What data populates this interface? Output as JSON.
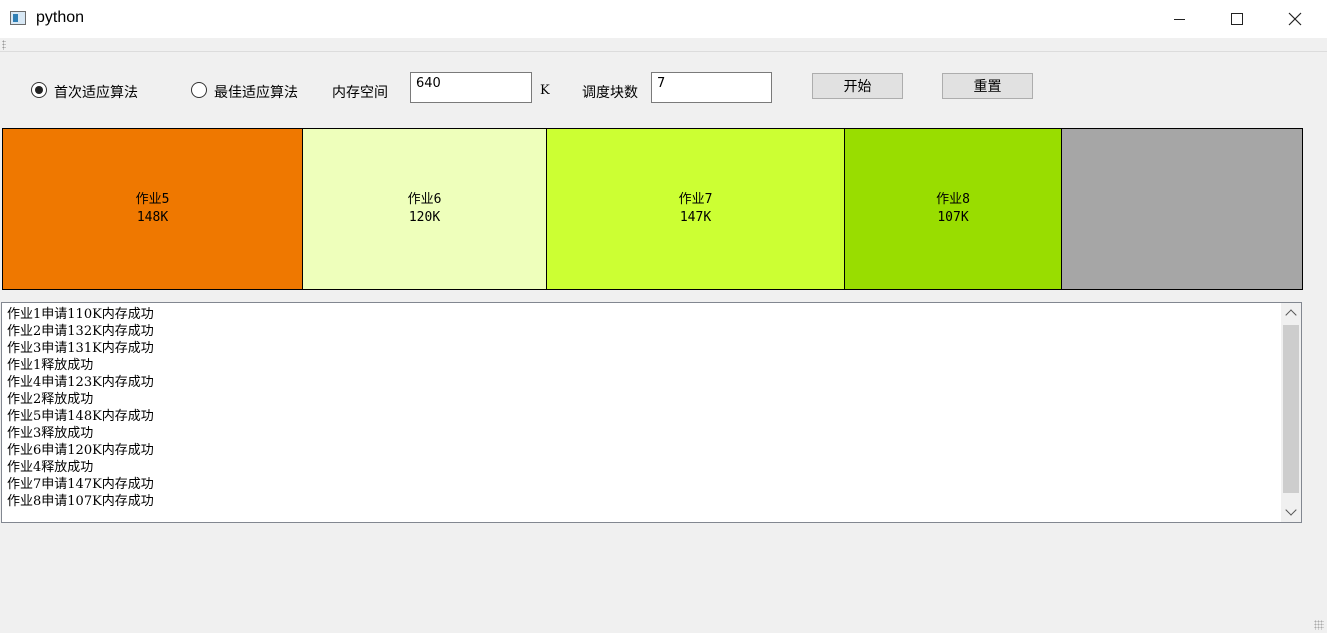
{
  "window": {
    "title": "python"
  },
  "controls": {
    "algo_first_fit": {
      "label": "首次适应算法",
      "checked": true
    },
    "algo_best_fit": {
      "label": "最佳适应算法",
      "checked": false
    },
    "memory_label": "内存空间",
    "memory_value": "640",
    "memory_unit": "K",
    "blocks_label": "调度块数",
    "blocks_value": "7",
    "start_label": "开始",
    "reset_label": "重置"
  },
  "memory": {
    "total_k": 640,
    "blocks": [
      {
        "name": "作业5",
        "size_label": "148K",
        "size_k": 148,
        "color": "#ef7800"
      },
      {
        "name": "作业6",
        "size_label": "120K",
        "size_k": 120,
        "color": "#eeffbb"
      },
      {
        "name": "作业7",
        "size_label": "147K",
        "size_k": 147,
        "color": "#ccff33"
      },
      {
        "name": "作业8",
        "size_label": "107K",
        "size_k": 107,
        "color": "#99dd00"
      }
    ],
    "free_color": "#a6a6a6"
  },
  "log": [
    "作业1申请110K内存成功",
    "作业2申请132K内存成功",
    "作业3申请131K内存成功",
    "作业1释放成功",
    "作业4申请123K内存成功",
    "作业2释放成功",
    "作业5申请148K内存成功",
    "作业3释放成功",
    "作业6申请120K内存成功",
    "作业4释放成功",
    "作业7申请147K内存成功",
    "作业8申请107K内存成功"
  ]
}
